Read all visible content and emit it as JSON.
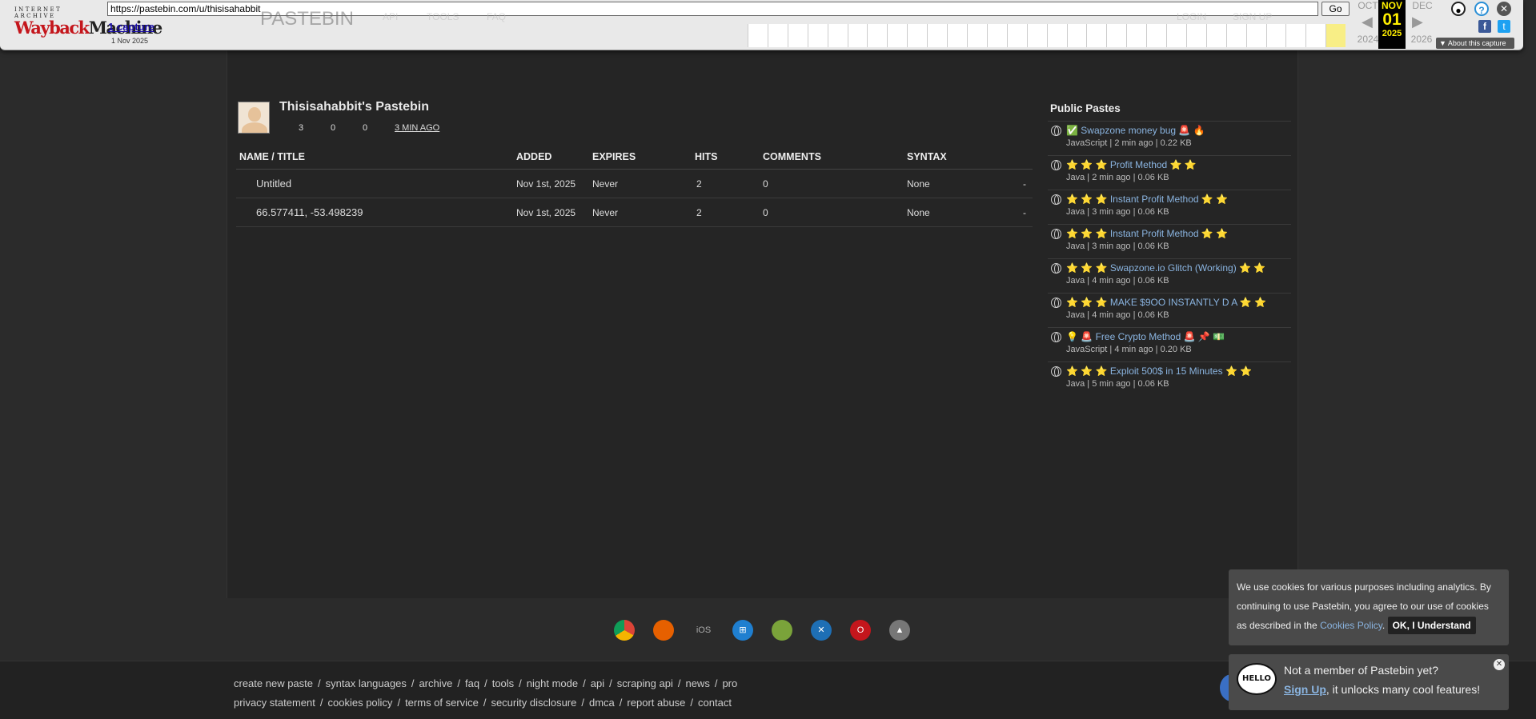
{
  "wayback": {
    "logo_top": "INTERNET ARCHIVE",
    "logo_main_1": "Wayback",
    "logo_main_2": "Machine",
    "url": "https://pastebin.com/u/thisisahabbit",
    "go_label": "Go",
    "captures": "1 capture",
    "capture_date": "1 Nov 2025",
    "prev_month": "OCT",
    "prev_year": "2024",
    "cur_month": "NOV",
    "cur_day": "01",
    "cur_year": "2025",
    "next_month": "DEC",
    "next_year": "2026",
    "about": "About this capture"
  },
  "bg_nav": [
    "PASTEBIN",
    "API",
    "TOOLS",
    "FAQ",
    "LOGIN",
    "SIGN UP"
  ],
  "profile": {
    "title": "Thisisahabbit's Pastebin",
    "stat_1": "3",
    "stat_2": "0",
    "stat_3": "0",
    "joined": "3 MIN AGO"
  },
  "table": {
    "headers": {
      "name": "NAME / TITLE",
      "added": "ADDED",
      "expires": "EXPIRES",
      "hits": "HITS",
      "comments": "COMMENTS",
      "syntax": "SYNTAX"
    },
    "rows": [
      {
        "name": "Untitled",
        "added": "Nov 1st, 2025",
        "expires": "Never",
        "hits": "2",
        "comments": "0",
        "syntax": "None",
        "action": "-"
      },
      {
        "name": "66.577411, -53.498239",
        "added": "Nov 1st, 2025",
        "expires": "Never",
        "hits": "2",
        "comments": "0",
        "syntax": "None",
        "action": "-"
      }
    ]
  },
  "sidebar": {
    "title": "Public Pastes",
    "items": [
      {
        "prefix": "✅",
        "title": "Swapzone money bug",
        "suffix": "🚨 🔥",
        "meta": "JavaScript | 2 min ago | 0.22 KB"
      },
      {
        "prefix": "⭐ ⭐ ⭐",
        "title": "Profit Method",
        "suffix": "⭐ ⭐",
        "meta": "Java | 2 min ago | 0.06 KB"
      },
      {
        "prefix": "⭐ ⭐ ⭐",
        "title": "Instant Profit Method",
        "suffix": "⭐ ⭐",
        "meta": "Java | 3 min ago | 0.06 KB"
      },
      {
        "prefix": "⭐ ⭐ ⭐",
        "title": "Instant Profit Method",
        "suffix": "⭐ ⭐",
        "meta": "Java | 3 min ago | 0.06 KB"
      },
      {
        "prefix": "⭐ ⭐ ⭐",
        "title": "Swapzone.io Glitch (Working)",
        "suffix": "⭐ ⭐",
        "meta": "Java | 4 min ago | 0.06 KB"
      },
      {
        "prefix": "⭐ ⭐ ⭐",
        "title": "MAKE $9OO INSTANTLY D A",
        "suffix": "⭐ ⭐",
        "meta": "Java | 4 min ago | 0.06 KB"
      },
      {
        "prefix": "💡 🚨",
        "title": "Free Crypto Method",
        "suffix": "🚨 📌 💵",
        "meta": "JavaScript | 4 min ago | 0.20 KB"
      },
      {
        "prefix": "⭐ ⭐ ⭐",
        "title": "Exploit 500$ in 15 Minutes",
        "suffix": "⭐ ⭐",
        "meta": "Java | 5 min ago | 0.06 KB"
      }
    ]
  },
  "apps": {
    "ios": "iOS"
  },
  "footer": {
    "row1": [
      "create new paste",
      "syntax languages",
      "archive",
      "faq",
      "tools",
      "night mode",
      "api",
      "scraping api",
      "news",
      "pro"
    ],
    "row2": [
      "privacy statement",
      "cookies policy",
      "terms of service",
      "security disclosure",
      "dmca",
      "report abuse",
      "contact"
    ]
  },
  "cookie": {
    "text": "We use cookies for various purposes including analytics. By continuing to use Pastebin, you agree to our use of cookies as described in the",
    "link": "Cookies Policy",
    "period": ".",
    "ok": "OK, I Understand"
  },
  "member": {
    "hello": "HELLO",
    "question": "Not a member of Pastebin yet?",
    "signup": "Sign Up",
    "rest": ", it unlocks many cool features!"
  }
}
